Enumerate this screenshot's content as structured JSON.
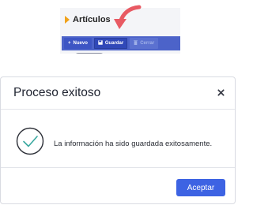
{
  "snippet": {
    "title": "Artículos",
    "toolbar": {
      "nuevo_label": "Nuevo",
      "nuevo_icon": "+",
      "guardar_label": "Guardar",
      "guardar_icon": "save-icon",
      "third_label": "Cerrar",
      "third_icon": "trash-icon"
    },
    "arrow_color": "#e85a63",
    "accent_marker_color": "#f0a21b",
    "toolbar_color": "#4c63c9"
  },
  "modal": {
    "title": "Proceso exitoso",
    "close_icon": "close-icon",
    "message": "La información ha sido guardada exitosamente.",
    "success_icon": "check-circle-icon",
    "success_color": "#3aa9a0",
    "accept_label": "Aceptar",
    "accept_color": "#3d63e3"
  }
}
